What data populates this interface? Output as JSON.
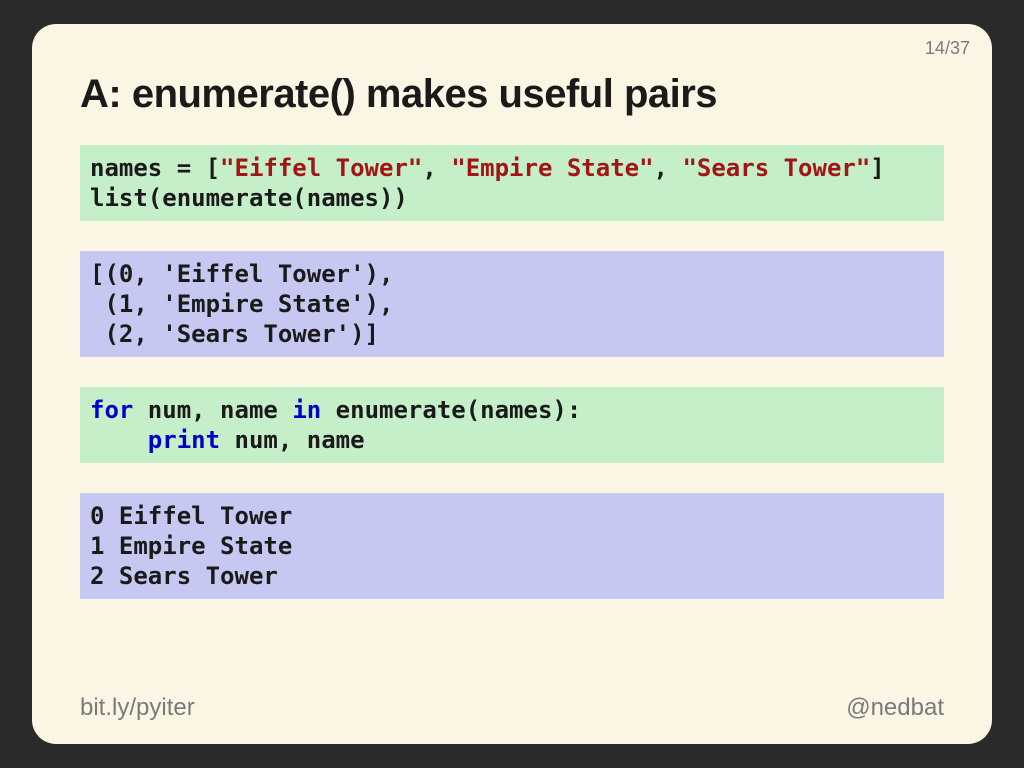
{
  "page": {
    "current": "14",
    "total": "37",
    "sep": "/"
  },
  "title": "A: enumerate() makes useful pairs",
  "code1": {
    "pre1": "names = [",
    "s1": "\"Eiffel Tower\"",
    "sep1": ", ",
    "s2": "\"Empire State\"",
    "sep2": ", ",
    "s3": "\"Sears Tower\"",
    "post1": "]\nlist(enumerate(names))"
  },
  "out1": "[(0, 'Eiffel Tower'),\n (1, 'Empire State'),\n (2, 'Sears Tower')]",
  "code2": {
    "kw_for": "for",
    "mid1": " num, name ",
    "kw_in": "in",
    "mid2": " enumerate(names):\n    ",
    "kw_print": "print",
    "tail": " num, name"
  },
  "out2": "0 Eiffel Tower\n1 Empire State\n2 Sears Tower",
  "footer": {
    "left": "bit.ly/pyiter",
    "right": "@nedbat"
  }
}
